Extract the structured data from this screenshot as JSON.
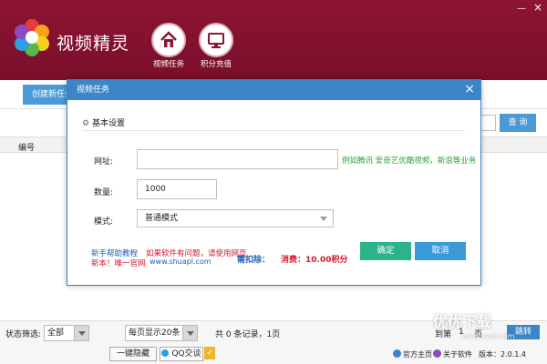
{
  "app": {
    "title": "视频精灵"
  },
  "nav": [
    {
      "label": "视频任务",
      "icon": "home-icon"
    },
    {
      "label": "积分充值",
      "icon": "monitor-icon"
    }
  ],
  "window_controls": {
    "minimize": "—",
    "close": "×"
  },
  "toolbar": {
    "create_label": "创建新任务"
  },
  "search": {
    "button_label": "查 询",
    "value": ""
  },
  "table": {
    "columns": [
      "编号"
    ]
  },
  "modal": {
    "title": "视频任务",
    "close": "×",
    "section_title": "基本设置",
    "fields": {
      "url": {
        "label": "网址:",
        "value": "",
        "hint": "例如腾讯 爱奇艺优酷视频，新浪等业务"
      },
      "qty": {
        "label": "数量:",
        "value": "1000"
      },
      "mode": {
        "label": "模式:",
        "value": "普通模式"
      }
    },
    "help_link": "新手帮助教程",
    "problem_text": "如果软件有问题，请使用网页",
    "new_text": "新本！唯一官网",
    "site": "www.shuapl.com",
    "deduct_label": "需扣除：",
    "cost_text": "消费：10.00积分",
    "ok_label": "确定",
    "cancel_label": "取消"
  },
  "status": {
    "filter_label": "状态筛选:",
    "filter_value": "全部",
    "per_page_value": "每页显示20条",
    "count_text": "共 0 条记录，1页",
    "goto_label": "到第",
    "goto_value": "1",
    "goto_unit": "页",
    "jump_label": "跳转",
    "hide_btn": "一键隐藏",
    "qq_btn": "QQ交谈",
    "homepage": "官方主页",
    "about": "关于软件",
    "version": "版本：2.0.1.4"
  },
  "watermark": {
    "text": "优优下载",
    "sub": "www.yyxt.com"
  },
  "colors": {
    "brand": "#8d1433",
    "accent": "#3a86c8",
    "ok": "#2bb38a",
    "cancel": "#3a9ad9",
    "link_red": "#d6192b",
    "link_blue": "#1d5fb8"
  }
}
